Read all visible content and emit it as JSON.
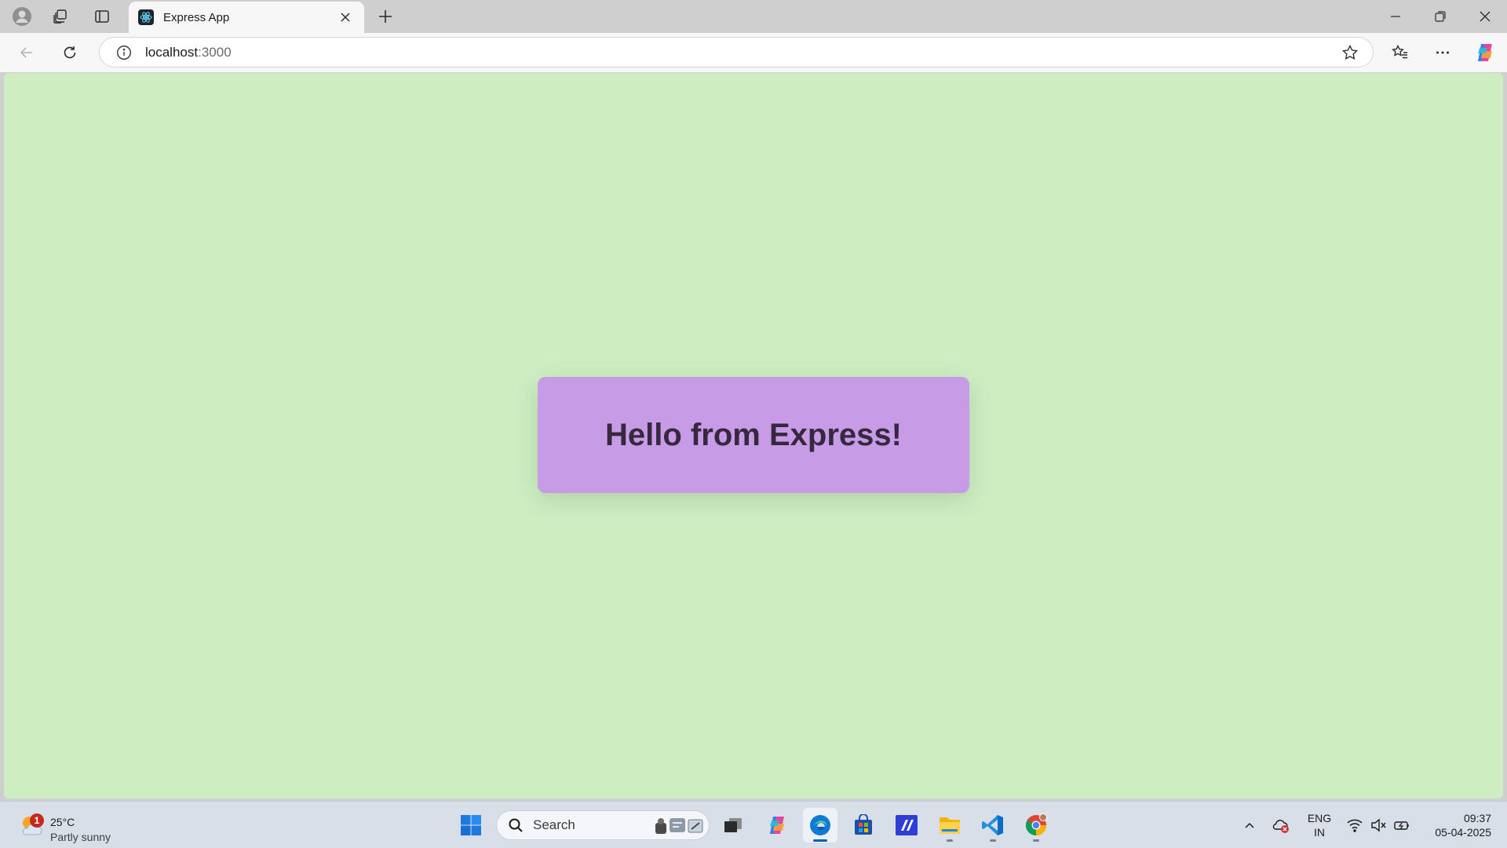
{
  "browser": {
    "tab": {
      "title": "Express App"
    },
    "address": {
      "host": "localhost",
      "port": ":3000"
    }
  },
  "page": {
    "heading": "Hello from Express!",
    "background_color": "#ceeec2",
    "card_color": "#c79be6"
  },
  "taskbar": {
    "weather": {
      "badge": "1",
      "temp": "25°C",
      "desc": "Partly sunny"
    },
    "search_label": "Search",
    "apps": [
      "windows-start-icon",
      "task-view-icon",
      "copilot-app-icon",
      "edge-icon",
      "store-icon",
      "ps-app-icon",
      "file-explorer-icon",
      "vscode-icon",
      "chrome-icon"
    ],
    "language": {
      "line1": "ENG",
      "line2": "IN"
    },
    "clock": {
      "time": "09:37",
      "date": "05-04-2025"
    }
  }
}
